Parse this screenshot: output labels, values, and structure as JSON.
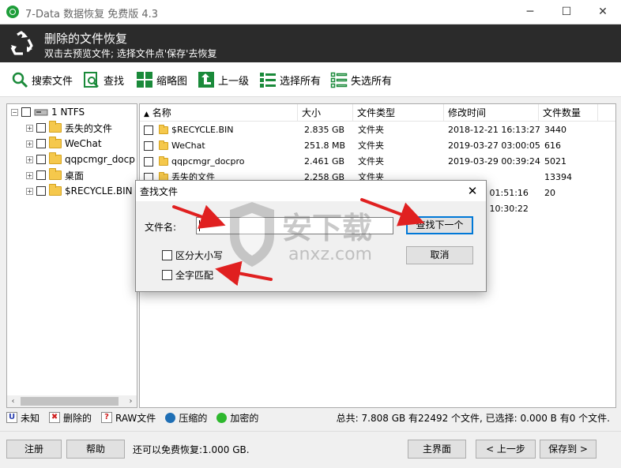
{
  "window": {
    "title": "7-Data 数据恢复 免费版 4.3",
    "controls": {
      "minimize": "─",
      "maximize": "☐",
      "close": "✕"
    }
  },
  "banner": {
    "title": "删除的文件恢复",
    "subtitle": "双击去预览文件; 选择文件点'保存'去恢复"
  },
  "toolbar": {
    "search_files": "搜索文件",
    "find": "查找",
    "thumbnails": "缩略图",
    "up_level": "上一级",
    "select_all": "选择所有",
    "deselect_all": "失选所有"
  },
  "tree": {
    "root": "1 NTFS",
    "items": [
      "丢失的文件",
      "WeChat",
      "qqpcmgr_docp",
      "桌面",
      "$RECYCLE.BIN"
    ]
  },
  "list": {
    "columns": [
      "名称",
      "大小",
      "文件类型",
      "修改时间",
      "文件数量"
    ],
    "rows": [
      {
        "name": "$RECYCLE.BIN",
        "size": "2.835 GB",
        "type": "文件夹",
        "modified": "2018-12-21 16:13:27",
        "count": "3440"
      },
      {
        "name": "WeChat",
        "size": "251.8 MB",
        "type": "文件夹",
        "modified": "2019-03-27 03:00:05",
        "count": "616"
      },
      {
        "name": "qqpcmgr_docpro",
        "size": "2.461 GB",
        "type": "文件夹",
        "modified": "2019-03-29 00:39:24",
        "count": "5021"
      },
      {
        "name": "丢失的文件",
        "size": "2.258 GB",
        "type": "文件夹",
        "modified": "",
        "count": "13394"
      },
      {
        "name": "",
        "size": "",
        "type": "",
        "modified": "9 01:51:16",
        "count": "20"
      },
      {
        "name": "",
        "size": "",
        "type": "",
        "modified": "5 10:30:22",
        "count": ""
      }
    ]
  },
  "legend": {
    "unknown": "未知",
    "deleted": "删除的",
    "raw": "RAW文件",
    "compressed": "压缩的",
    "encrypted": "加密的",
    "status": "总共: 7.808 GB 有22492 个文件, 已选择: 0.000 B 有0 个文件."
  },
  "bottom": {
    "register": "注册",
    "help": "帮助",
    "free_info": "还可以免费恢复:1.000 GB.",
    "main": "主界面",
    "prev": "< 上一步",
    "save": "保存到 >"
  },
  "dialog": {
    "title": "查找文件",
    "close": "✕",
    "filename_label": "文件名:",
    "filename_value": "",
    "find_next": "查找下一个",
    "cancel": "取消",
    "case_sensitive": "区分大小写",
    "whole_match": "全字匹配"
  },
  "watermark": {
    "text1": "安下载",
    "text2": "anxz.com"
  },
  "colors": {
    "annotation_arrow": "#e02020",
    "banner_bg": "#2b2b2b",
    "primary_border": "#0078d7"
  }
}
